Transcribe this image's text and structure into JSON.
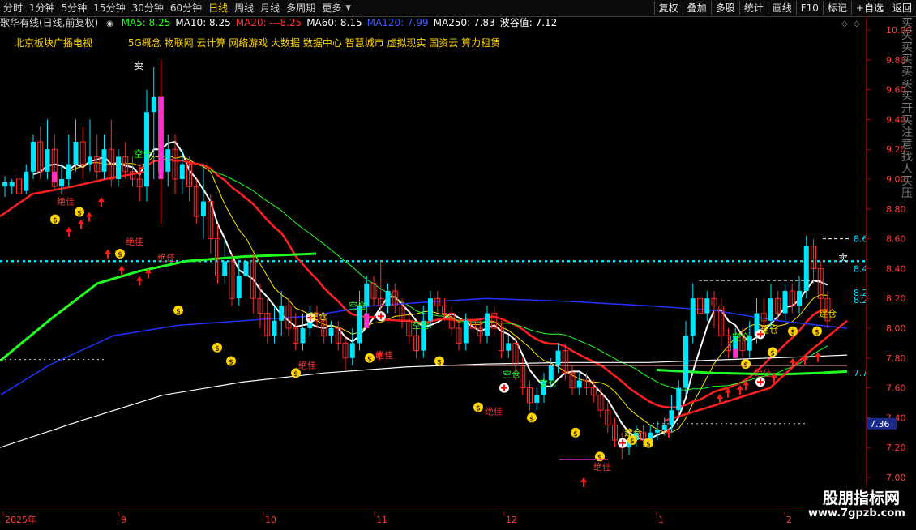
{
  "toolbar": {
    "periods": [
      {
        "label": "分时",
        "active": false
      },
      {
        "label": "1分钟",
        "active": false
      },
      {
        "label": "5分钟",
        "active": false
      },
      {
        "label": "15分钟",
        "active": false
      },
      {
        "label": "30分钟",
        "active": false
      },
      {
        "label": "60分钟",
        "active": false
      },
      {
        "label": "日线",
        "active": true
      },
      {
        "label": "周线",
        "active": false
      },
      {
        "label": "月线",
        "active": false
      },
      {
        "label": "多周期",
        "active": false
      },
      {
        "label": "更多",
        "active": false
      }
    ],
    "buttons": [
      "复权",
      "叠加",
      "多股",
      "统计",
      "画线",
      "F10",
      "标记",
      "+自选",
      "返回"
    ]
  },
  "legend": {
    "title": "歌华有线(日线,前复权)",
    "items": [
      {
        "text": "MA5: 8.25",
        "color": "#ffffff"
      },
      {
        "text": "MA10: 8.25",
        "color": "#ffffff"
      },
      {
        "text": "MA20: ---8.25",
        "color": "#ff3030"
      },
      {
        "text": "MA60: 8.15",
        "color": "#ffffff"
      },
      {
        "text": "MA120: 7.99",
        "color": "#3a5cff"
      },
      {
        "text": "MA250: 7.83",
        "color": "#ffffff"
      },
      {
        "text": "波谷值: 7.12",
        "color": "#ffffff"
      }
    ]
  },
  "tags": [
    "北京板块广播电视",
    "5G概念 物联网 云计算 网络游戏 大数据 数据中心 智慧城市 虚拟现实 国资云 算力租赁"
  ],
  "yaxis": {
    "ticks": [
      "10.00",
      "9.80",
      "9.60",
      "9.40",
      "9.20",
      "9.00",
      "8.80",
      "8.60",
      "8.40",
      "8.20",
      "8.00",
      "7.80",
      "7.60",
      "7.40",
      "7.20",
      "7.00"
    ],
    "current": "7.36"
  },
  "xaxis": {
    "labels": [
      "2025年",
      "9",
      "10",
      "11",
      "12",
      "1",
      "2"
    ]
  },
  "annotations": {
    "sell": "卖",
    "best": "绝佳",
    "empty": "空仓",
    "build": "建仓",
    "lines": [
      "8.6",
      "8.4",
      "8.2",
      "8.2",
      "7.7"
    ]
  },
  "watermark": {
    "title": "股朋指标网",
    "url": "www.7gpzb.com"
  },
  "colors": {
    "up": "#00e5ff",
    "down": "#ff2a2a",
    "bright": "#ff33cc",
    "ma_white": "#ffffff",
    "ma_yellow": "#ffe600",
    "ma_green": "#22ff22",
    "ma_blue": "#2233ff",
    "ma_red": "#ff2020"
  },
  "chart_data": {
    "type": "candlestick",
    "ylim": [
      6.95,
      10.08
    ],
    "candles": [
      [
        8.95,
        8.98,
        8.88,
        9.02
      ],
      [
        8.95,
        8.98,
        8.9,
        9.0
      ],
      [
        9.0,
        8.9,
        8.85,
        9.05
      ],
      [
        8.92,
        9.05,
        8.9,
        9.1
      ],
      [
        9.05,
        9.25,
        9.0,
        9.3
      ],
      [
        9.25,
        9.05,
        9.0,
        9.35
      ],
      [
        9.05,
        9.2,
        9.0,
        9.4
      ],
      [
        9.2,
        8.95,
        8.92,
        9.3
      ],
      [
        8.95,
        9.0,
        8.9,
        9.1
      ],
      [
        9.0,
        9.1,
        8.95,
        9.3
      ],
      [
        9.1,
        9.25,
        9.05,
        9.4
      ],
      [
        9.25,
        9.1,
        9.0,
        9.35
      ],
      [
        9.1,
        9.15,
        9.05,
        9.4
      ],
      [
        9.15,
        9.05,
        9.0,
        9.3
      ],
      [
        9.05,
        9.2,
        9.0,
        9.3
      ],
      [
        9.2,
        9.0,
        8.95,
        9.4
      ],
      [
        9.0,
        9.15,
        8.95,
        9.2
      ],
      [
        9.15,
        9.05,
        9.0,
        9.25
      ],
      [
        9.05,
        9.0,
        8.95,
        9.15
      ],
      [
        9.0,
        8.95,
        8.85,
        9.1
      ],
      [
        8.95,
        9.45,
        8.85,
        9.6
      ],
      [
        9.45,
        9.55,
        9.0,
        9.75
      ],
      [
        9.55,
        9.05,
        8.7,
        9.8
      ],
      [
        9.05,
        9.2,
        8.95,
        9.3
      ],
      [
        9.2,
        9.0,
        8.9,
        9.3
      ],
      [
        9.0,
        9.1,
        8.9,
        9.2
      ],
      [
        9.1,
        8.95,
        8.85,
        9.15
      ],
      [
        8.95,
        8.75,
        8.7,
        9.0
      ],
      [
        8.75,
        8.85,
        8.6,
        9.1
      ],
      [
        8.85,
        8.6,
        8.5,
        8.9
      ],
      [
        8.6,
        8.35,
        8.3,
        8.7
      ],
      [
        8.35,
        8.45,
        8.3,
        8.6
      ],
      [
        8.45,
        8.2,
        8.15,
        8.5
      ],
      [
        8.2,
        8.35,
        8.15,
        8.45
      ],
      [
        8.35,
        8.45,
        8.2,
        8.5
      ],
      [
        8.45,
        8.2,
        8.1,
        8.5
      ],
      [
        8.2,
        8.1,
        8.0,
        8.3
      ],
      [
        8.1,
        7.95,
        7.9,
        8.2
      ],
      [
        7.95,
        8.05,
        7.9,
        8.15
      ],
      [
        8.05,
        8.15,
        7.95,
        8.25
      ],
      [
        8.15,
        8.0,
        7.95,
        8.2
      ],
      [
        8.0,
        7.9,
        7.85,
        8.1
      ],
      [
        7.9,
        8.0,
        7.85,
        8.1
      ],
      [
        8.0,
        8.1,
        7.95,
        8.15
      ],
      [
        8.1,
        8.05,
        8.0,
        8.15
      ],
      [
        8.05,
        7.95,
        7.9,
        8.1
      ],
      [
        7.95,
        8.0,
        7.9,
        8.05
      ],
      [
        8.0,
        7.9,
        7.85,
        8.05
      ],
      [
        7.9,
        7.8,
        7.72,
        7.95
      ],
      [
        7.8,
        7.9,
        7.75,
        8.0
      ],
      [
        7.9,
        8.15,
        7.85,
        8.25
      ],
      [
        8.15,
        8.3,
        8.1,
        8.35
      ],
      [
        8.3,
        8.2,
        8.15,
        8.35
      ],
      [
        8.2,
        8.15,
        8.1,
        8.45
      ],
      [
        8.15,
        8.25,
        8.1,
        8.3
      ],
      [
        8.25,
        8.15,
        8.1,
        8.3
      ],
      [
        8.15,
        8.05,
        8.0,
        8.2
      ],
      [
        8.05,
        7.95,
        7.9,
        8.1
      ],
      [
        7.95,
        7.85,
        7.8,
        8.0
      ],
      [
        7.85,
        8.05,
        7.8,
        8.15
      ],
      [
        8.05,
        8.2,
        8.0,
        8.25
      ],
      [
        8.2,
        8.15,
        8.1,
        8.25
      ],
      [
        8.15,
        8.1,
        8.05,
        8.2
      ],
      [
        8.1,
        8.0,
        7.95,
        8.15
      ],
      [
        8.0,
        7.9,
        7.85,
        8.05
      ],
      [
        7.9,
        8.05,
        7.85,
        8.1
      ],
      [
        8.05,
        8.0,
        7.95,
        8.1
      ],
      [
        8.0,
        7.95,
        7.9,
        8.05
      ],
      [
        7.95,
        8.1,
        7.9,
        8.15
      ],
      [
        8.1,
        8.0,
        7.95,
        8.15
      ],
      [
        8.0,
        7.85,
        7.8,
        8.05
      ],
      [
        7.85,
        7.9,
        7.8,
        7.95
      ],
      [
        7.9,
        7.75,
        7.65,
        7.95
      ],
      [
        7.75,
        7.6,
        7.55,
        7.8
      ],
      [
        7.6,
        7.5,
        7.45,
        7.65
      ],
      [
        7.5,
        7.55,
        7.45,
        7.6
      ],
      [
        7.55,
        7.65,
        7.5,
        7.7
      ],
      [
        7.65,
        7.75,
        7.6,
        7.8
      ],
      [
        7.75,
        7.85,
        7.7,
        7.9
      ],
      [
        7.85,
        7.7,
        7.65,
        7.9
      ],
      [
        7.7,
        7.6,
        7.55,
        7.75
      ],
      [
        7.6,
        7.65,
        7.55,
        7.7
      ],
      [
        7.65,
        7.6,
        7.55,
        7.7
      ],
      [
        7.6,
        7.55,
        7.5,
        7.65
      ],
      [
        7.55,
        7.45,
        7.4,
        7.6
      ],
      [
        7.45,
        7.35,
        7.3,
        7.5
      ],
      [
        7.35,
        7.25,
        7.2,
        7.4
      ],
      [
        7.25,
        7.2,
        7.12,
        7.3
      ],
      [
        7.2,
        7.25,
        7.15,
        7.3
      ],
      [
        7.25,
        7.3,
        7.2,
        7.35
      ],
      [
        7.3,
        7.25,
        7.2,
        7.35
      ],
      [
        7.25,
        7.3,
        7.2,
        7.35
      ],
      [
        7.3,
        7.32,
        7.25,
        7.38
      ],
      [
        7.32,
        7.35,
        7.28,
        7.4
      ],
      [
        7.35,
        7.45,
        7.3,
        7.55
      ],
      [
        7.45,
        7.6,
        7.4,
        7.65
      ],
      [
        7.6,
        7.95,
        7.55,
        8.05
      ],
      [
        7.95,
        8.2,
        7.9,
        8.3
      ],
      [
        8.2,
        8.1,
        8.05,
        8.25
      ],
      [
        8.1,
        8.2,
        8.05,
        8.25
      ],
      [
        8.2,
        8.15,
        8.0,
        8.25
      ],
      [
        8.15,
        7.95,
        7.85,
        8.2
      ],
      [
        7.95,
        7.85,
        7.8,
        8.0
      ],
      [
        7.85,
        7.95,
        7.8,
        8.0
      ],
      [
        7.95,
        7.85,
        7.8,
        8.0
      ],
      [
        7.85,
        7.95,
        7.8,
        8.05
      ],
      [
        7.95,
        8.1,
        7.9,
        8.2
      ],
      [
        8.1,
        8.05,
        8.0,
        8.2
      ],
      [
        8.05,
        8.2,
        8.0,
        8.3
      ],
      [
        8.2,
        8.1,
        8.05,
        8.25
      ],
      [
        8.1,
        8.25,
        8.05,
        8.3
      ],
      [
        8.25,
        8.15,
        8.1,
        8.3
      ],
      [
        8.15,
        8.25,
        8.1,
        8.35
      ],
      [
        8.25,
        8.55,
        8.2,
        8.62
      ],
      [
        8.55,
        8.4,
        8.3,
        8.6
      ],
      [
        8.4,
        8.2,
        8.1,
        8.45
      ],
      [
        8.2,
        8.05,
        8.0,
        8.25
      ]
    ]
  }
}
